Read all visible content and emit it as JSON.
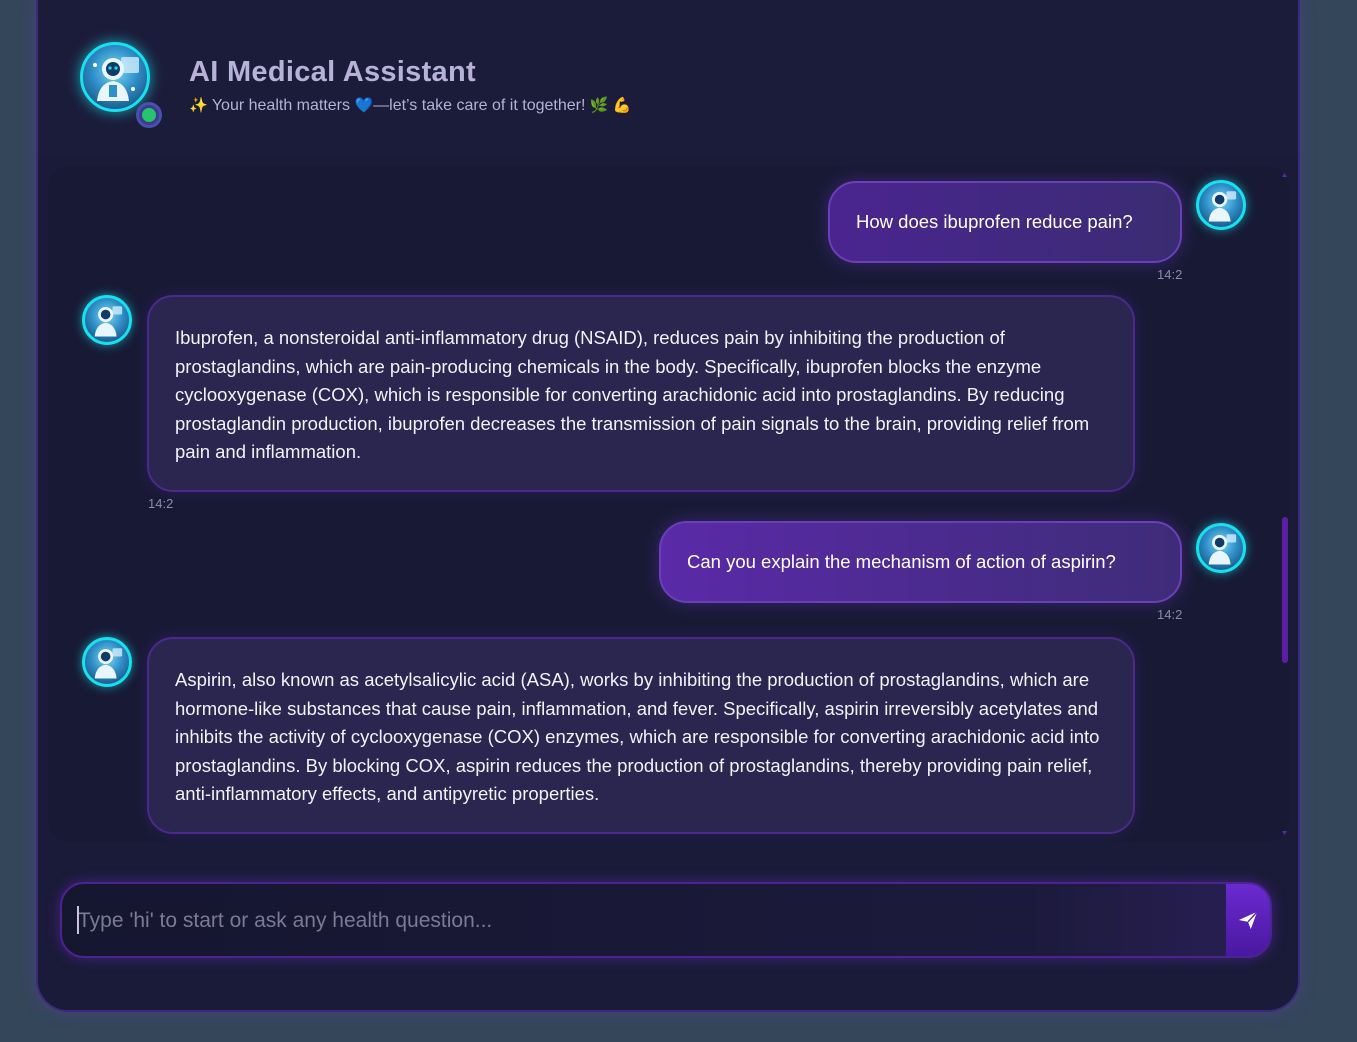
{
  "header": {
    "title": "AI Medical Assistant",
    "subtitle_prefix_emoji": "✨",
    "subtitle_text_1": "Your health matters",
    "subtitle_heart_emoji": "💙",
    "subtitle_text_2": "—let’s take care of it together!",
    "subtitle_suffix_emojis": "🌿 💪",
    "status": "online"
  },
  "messages": [
    {
      "role": "user",
      "text": "How does ibuprofen reduce pain?",
      "time": "14:2"
    },
    {
      "role": "assistant",
      "text": "Ibuprofen, a nonsteroidal anti-inflammatory drug (NSAID), reduces pain by inhibiting the production of prostaglandins, which are pain-producing chemicals in the body. Specifically, ibuprofen blocks the enzyme cyclooxygenase (COX), which is responsible for converting arachidonic acid into prostaglandins. By reducing prostaglandin production, ibuprofen decreases the transmission of pain signals to the brain, providing relief from pain and inflammation.",
      "time": "14:2"
    },
    {
      "role": "user",
      "text": "Can you explain the mechanism of action of aspirin?",
      "time": "14:2"
    },
    {
      "role": "assistant",
      "text": "Aspirin, also known as acetylsalicylic acid (ASA), works by inhibiting the production of prostaglandins, which are hormone-like substances that cause pain, inflammation, and fever. Specifically, aspirin irreversibly acetylates and inhibits the activity of cyclooxygenase (COX) enzymes, which are responsible for converting arachidonic acid into prostaglandins. By blocking COX, aspirin reduces the production of prostaglandins, thereby providing pain relief, anti-inflammatory effects, and antipyretic properties.",
      "time": "14:2"
    }
  ],
  "composer": {
    "placeholder": "Type 'hi' to start or ask any health question...",
    "value": "",
    "send_icon": "send-icon"
  },
  "colors": {
    "page_bg": "#34465a",
    "panel_bg": "#1a1b38",
    "accent_cyan": "#19e0ee",
    "accent_purple": "#6a3fb8",
    "online": "#27c46d"
  }
}
